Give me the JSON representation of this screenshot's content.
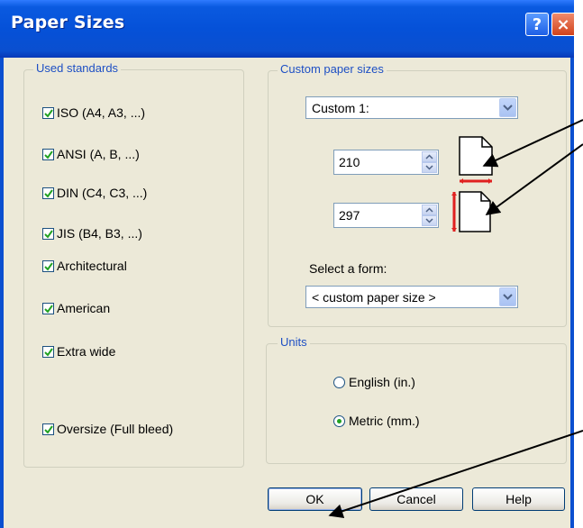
{
  "window": {
    "title": "Paper Sizes",
    "help_glyph": "?",
    "close_glyph": "×"
  },
  "used_standards": {
    "label": "Used standards",
    "items": [
      {
        "label": "ISO (A4, A3, ...)",
        "checked": true
      },
      {
        "label": "ANSI (A, B, ...)",
        "checked": true
      },
      {
        "label": "DIN (C4, C3, ...)",
        "checked": true
      },
      {
        "label": "JIS (B4, B3, ...)",
        "checked": true
      },
      {
        "label": "Architectural",
        "checked": true
      },
      {
        "label": "American",
        "checked": true
      },
      {
        "label": "Extra wide",
        "checked": true
      },
      {
        "label": "Oversize (Full bleed)",
        "checked": true
      }
    ]
  },
  "custom_paper_sizes": {
    "label": "Custom paper sizes",
    "preset_value": "Custom 1:",
    "width_value": "210",
    "height_value": "297",
    "form_label": "Select a form:",
    "form_value": "< custom paper size >"
  },
  "units": {
    "label": "Units",
    "options": [
      {
        "label": "English (in.)",
        "selected": false
      },
      {
        "label": "Metric (mm.)",
        "selected": true
      }
    ]
  },
  "buttons": {
    "ok": "OK",
    "cancel": "Cancel",
    "help": "Help"
  },
  "colors": {
    "title_bar": "#0551d8",
    "dialog_bg": "#ece9d8",
    "group_label": "#1d4fc4",
    "check_mark": "#21a121",
    "dimension_marker": "#e02020"
  },
  "icons": {
    "help": "question-icon",
    "close": "close-icon",
    "dropdown": "chevron-down-icon",
    "spinner": "spinner-arrows-icon",
    "page": "page-icon"
  }
}
